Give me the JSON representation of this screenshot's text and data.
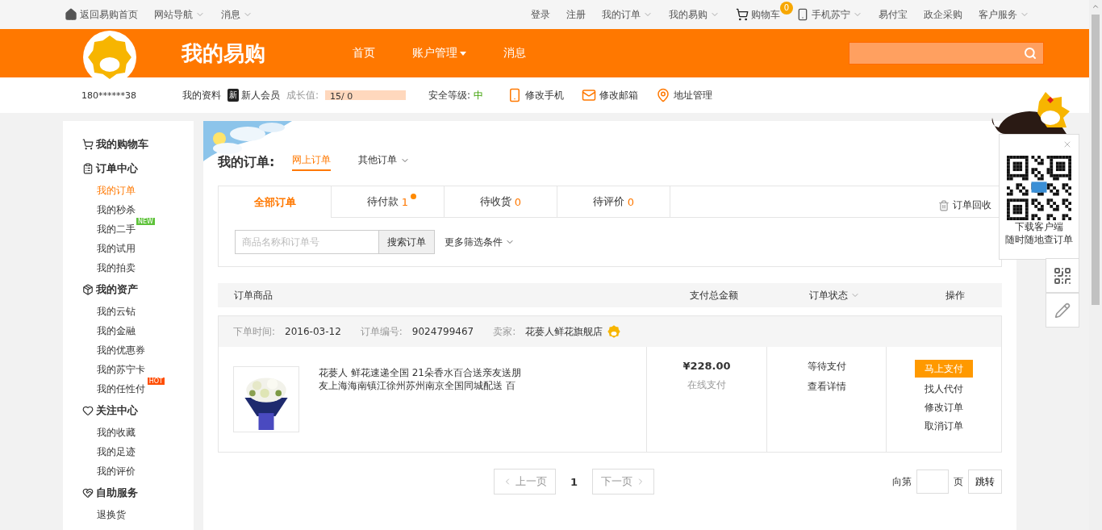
{
  "top_bar": {
    "left": [
      {
        "label": "返回易购首页",
        "dropdown": false
      },
      {
        "label": "网站导航",
        "dropdown": true
      },
      {
        "label": "消息",
        "dropdown": true
      }
    ],
    "right": [
      {
        "label": "登录",
        "dropdown": false
      },
      {
        "label": "注册",
        "dropdown": false
      },
      {
        "label": "我的订单",
        "dropdown": true
      },
      {
        "label": "我的易购",
        "dropdown": true
      },
      {
        "label": "购物车",
        "count": "0",
        "dropdown": false
      },
      {
        "label": "手机苏宁",
        "dropdown": true
      },
      {
        "label": "易付宝",
        "dropdown": false
      },
      {
        "label": "政企采购",
        "dropdown": false
      },
      {
        "label": "客户服务",
        "dropdown": true
      }
    ]
  },
  "header": {
    "brand": "我的易购",
    "nav": [
      {
        "label": "首页",
        "dropdown": false
      },
      {
        "label": "账户管理",
        "dropdown": true
      },
      {
        "label": "消息",
        "dropdown": false
      }
    ]
  },
  "profile": {
    "user": "180******38",
    "profile_link": "我的资料",
    "member_badge": "新",
    "member_level": "新人会员",
    "growth_label": "成长值:",
    "growth": {
      "reading": "15/ 0",
      "level": 1
    },
    "security_label": "安全等级:",
    "security_value": "中",
    "actions": [
      {
        "label": "修改手机"
      },
      {
        "label": "修改邮箱"
      },
      {
        "label": "地址管理"
      }
    ]
  },
  "sidebar": [
    {
      "title": "我的购物车"
    },
    {
      "title": "订单中心",
      "items": [
        {
          "label": "我的订单",
          "selected": true
        },
        {
          "label": "我的秒杀",
          "selected": false
        },
        {
          "label": "我的二手",
          "selected": false,
          "badge": "NEW",
          "color": "#5ec23a"
        },
        {
          "label": "我的试用",
          "selected": false
        },
        {
          "label": "我的拍卖",
          "selected": false
        }
      ]
    },
    {
      "title": "我的资产",
      "items": [
        {
          "label": "我的云钻",
          "selected": false
        },
        {
          "label": "我的金融",
          "selected": false
        },
        {
          "label": "我的优惠券",
          "selected": false
        },
        {
          "label": "我的苏宁卡",
          "selected": false
        },
        {
          "label": "我的任性付",
          "selected": false,
          "badge": "HOT",
          "color": "#ff4e00"
        }
      ]
    },
    {
      "title": "关注中心",
      "items": [
        {
          "label": "我的收藏",
          "selected": false
        },
        {
          "label": "我的足迹",
          "selected": false
        },
        {
          "label": "我的评价",
          "selected": false
        }
      ]
    },
    {
      "title": "自助服务",
      "items": [
        {
          "label": "退换货",
          "selected": false
        }
      ]
    }
  ],
  "orders": {
    "title": "我的订单:",
    "source_tabs": [
      {
        "label": "网上订单",
        "selected": true,
        "dropdown": false
      },
      {
        "label": "其他订单",
        "selected": false,
        "dropdown": true
      }
    ],
    "status_tabs": [
      {
        "label": "全部订单",
        "selected": true,
        "alert": false
      },
      {
        "label": "待付款",
        "count": "1",
        "selected": false,
        "alert": true
      },
      {
        "label": "待收货",
        "count": "0",
        "selected": false,
        "alert": false
      },
      {
        "label": "待评价",
        "count": "0",
        "selected": false,
        "alert": false
      }
    ],
    "recycle": "订单回收",
    "search": {
      "placeholder": "商品名称和订单号",
      "button": "搜索订单"
    },
    "filter": "更多筛选条件",
    "columns": [
      {
        "label": "订单商品",
        "dropdown": false
      },
      {
        "label": "支付总金额",
        "dropdown": false
      },
      {
        "label": "订单状态",
        "dropdown": true
      },
      {
        "label": "操作",
        "dropdown": false
      }
    ],
    "rows": [
      {
        "date_label": "下单时间:",
        "date": "2016-03-12",
        "number_label": "订单编号:",
        "number": "9024799467",
        "seller_label": "卖家:",
        "seller": "花蒌人鲜花旗舰店",
        "product": "花蒌人 鲜花速递全国 21朵香水百合送亲友送朋友上海海南镇江徐州苏州南京全国同城配送 百",
        "amount": "¥228.00",
        "payment": "在线支付",
        "status": "等待支付",
        "details": "查看详情",
        "primary_action": "马上支付",
        "actions": [
          "找人代付",
          "修改订单",
          "取消订单"
        ]
      }
    ],
    "pagination": {
      "prev": "上一页",
      "pages": [
        {
          "label": "1",
          "selected": true
        }
      ],
      "next": "下一页",
      "jump_prefix": "向第",
      "jump_suffix": "页",
      "jump_button": "跳转"
    }
  },
  "app_panel": {
    "caption": [
      "下载客户端",
      "随时随地查订单"
    ]
  }
}
